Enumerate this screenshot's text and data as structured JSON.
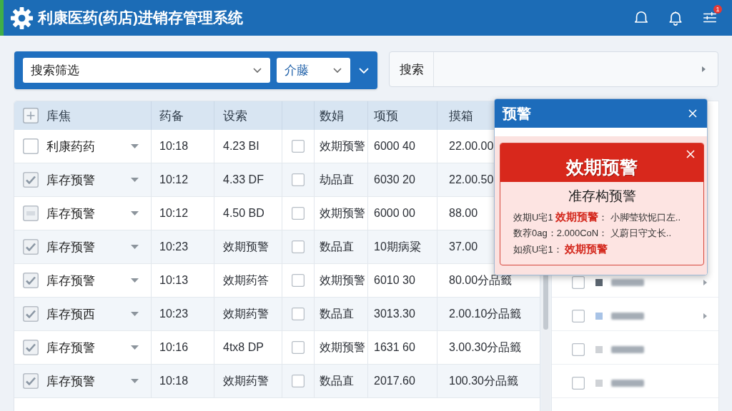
{
  "header": {
    "title": "利康医药(药店)进销存管理系统",
    "badge": "1"
  },
  "filter": {
    "select_1": "搜索筛选",
    "select_2": "介藤"
  },
  "search": {
    "label": "搜索"
  },
  "table": {
    "columns": [
      {
        "kind": "selector",
        "label": "库焦"
      },
      {
        "kind": "text",
        "label": "药备"
      },
      {
        "kind": "text",
        "label": "设索"
      },
      {
        "kind": "checkbox"
      },
      {
        "kind": "text",
        "label": "数娟"
      },
      {
        "kind": "text",
        "label": "项预"
      },
      {
        "kind": "text",
        "label": "摸箱"
      }
    ],
    "rows": [
      {
        "checked": false,
        "mixed": false,
        "name": "利康药药",
        "flagged": false,
        "values": [
          "10:18",
          "4.23 BI",
          "效期预警",
          "6000 40",
          "22.00.00"
        ]
      },
      {
        "checked": true,
        "mixed": false,
        "name": "库存预警",
        "flagged": false,
        "values": [
          "10:12",
          "4.33 DF",
          "劫品直",
          "6030 20",
          "22.00.50"
        ]
      },
      {
        "checked": false,
        "mixed": true,
        "name": "库存预警",
        "flagged": false,
        "values": [
          "10:12",
          "4.50 BD",
          "效期预警",
          "6000 00",
          "88.00"
        ]
      },
      {
        "checked": true,
        "mixed": false,
        "name": "库存预警",
        "flagged": false,
        "values": [
          "10:23",
          "效期预警",
          "数品直",
          "10期病粱",
          "37.00"
        ]
      },
      {
        "checked": true,
        "mixed": false,
        "name": "库存预警",
        "flagged": false,
        "values": [
          "10:13",
          "效期药答",
          "效期预警",
          "6010 30",
          "80.00分品籤"
        ]
      },
      {
        "checked": true,
        "mixed": false,
        "name": "库存预西",
        "flagged": false,
        "values": [
          "10:23",
          "效期药警",
          "数品直",
          "3013.30",
          "2.00.10分品籤"
        ]
      },
      {
        "checked": true,
        "mixed": false,
        "name": "库存预警",
        "flagged": false,
        "values": [
          "10:16",
          "4tx8 DP",
          "效期预警",
          "1631 60",
          "3.00.30分品籤"
        ]
      },
      {
        "checked": true,
        "mixed": false,
        "name": "库存预警",
        "flagged": false,
        "values": [
          "10:18",
          "效期药警",
          "数品直",
          "2017.60",
          "100.30分品籤"
        ]
      }
    ]
  },
  "side_list": [
    {
      "checked": false,
      "color": "#5b6570",
      "has_arrow": true
    },
    {
      "checked": false,
      "color": "#a8c3e6",
      "has_arrow": true
    },
    {
      "checked": false,
      "color": "#cfd2d6",
      "has_arrow": false
    },
    {
      "checked": false,
      "color": "#cfd2d6",
      "has_arrow": false
    }
  ],
  "popup": {
    "title": "预警",
    "alert": {
      "title": "效期预警",
      "subtitle": "准存构预警",
      "lines": [
        {
          "parts": [
            {
              "text": "效期U宅1 ",
              "highlight": false
            },
            {
              "text": "效期预警",
              "highlight": true
            },
            {
              "text": "： 小脚莹软怩口左..",
              "highlight": false
            }
          ]
        },
        {
          "parts": [
            {
              "text": "数荐0ag：2.000CoN： 乂蔚日守文长..",
              "highlight": false
            }
          ]
        },
        {
          "parts": [
            {
              "text": "如殡U宅1： ",
              "highlight": false
            },
            {
              "text": "效期预警",
              "highlight": true
            }
          ]
        }
      ]
    }
  }
}
